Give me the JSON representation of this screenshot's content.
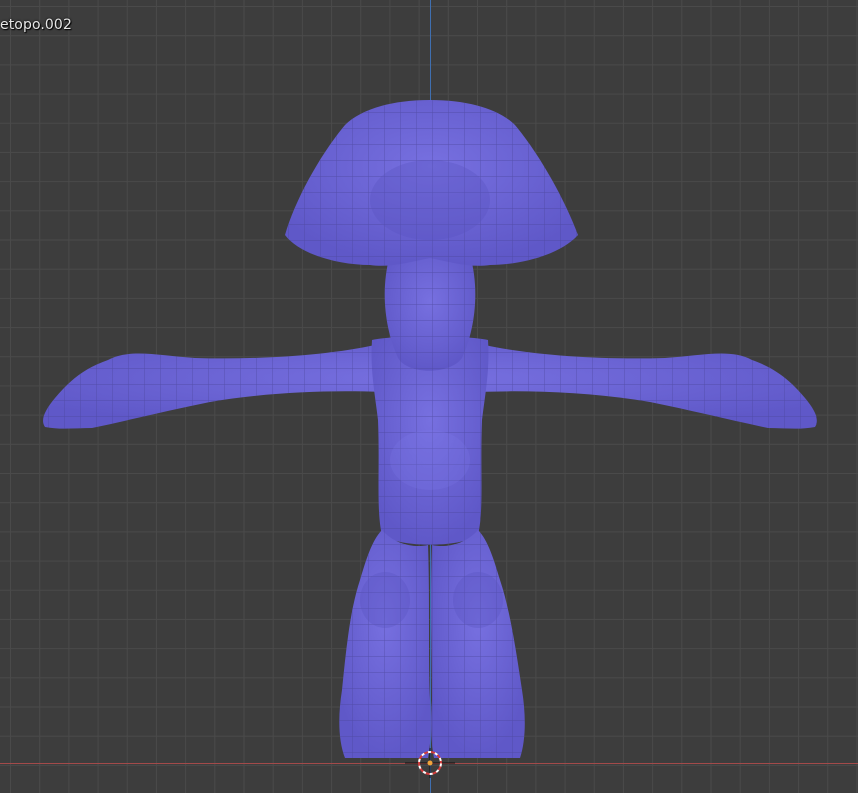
{
  "viewport": {
    "object_name": "etopo.002",
    "colors": {
      "background": "#3d3d3d",
      "grid": "#4a4a4a",
      "z_axis": "#3f6fb0",
      "x_axis": "#a34a4a",
      "mesh_fill": "#6f67d8",
      "mesh_wire": "#4a4598"
    },
    "model": {
      "icon": "sculpt-mesh-figure"
    },
    "cursor": {
      "icon": "3d-cursor-icon"
    }
  }
}
